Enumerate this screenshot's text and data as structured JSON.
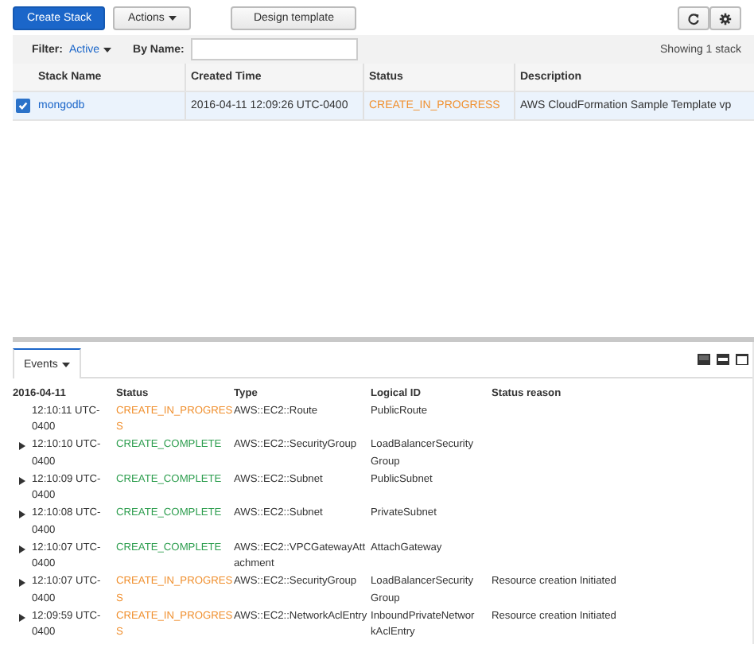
{
  "toolbar": {
    "create_button": "Create Stack",
    "actions_button": "Actions",
    "design_button": "Design template"
  },
  "filter": {
    "label": "Filter:",
    "value": "Active",
    "by_name_label": "By Name:",
    "count": "Showing 1 stack"
  },
  "stacks": {
    "columns": [
      "Stack Name",
      "Created Time",
      "Status",
      "Description"
    ],
    "rows": [
      {
        "checked": true,
        "selected": true,
        "name": "mongodb",
        "created": "2016-04-11 12:09:26 UTC-0400",
        "status": "CREATE_IN_PROGRESS",
        "color": "#f0902f",
        "description": "AWS CloudFormation Sample Template vp"
      }
    ]
  },
  "tabs": [
    {
      "label": "Events",
      "selected": true
    }
  ],
  "events": {
    "date": "2016-04-11",
    "columns": [
      "Status",
      "Type",
      "Logical ID",
      "Status reason"
    ],
    "rows": [
      {
        "expandable": false,
        "time": "12:10:11 UTC-0400",
        "status": "CREATE_IN_PROGRESS",
        "color": "#f0902f",
        "type": "AWS::EC2::Route",
        "logical_id": "PublicRoute"
      },
      {
        "expandable": true,
        "time": "12:10:10 UTC-0400",
        "status": "CREATE_COMPLETE",
        "color": "#2e9e4f",
        "type": "AWS::EC2::SecurityGroup",
        "logical_id": "LoadBalancerSecurityGroup"
      },
      {
        "expandable": true,
        "time": "12:10:09 UTC-0400",
        "status": "CREATE_COMPLETE",
        "color": "#2e9e4f",
        "type": "AWS::EC2::Subnet",
        "logical_id": "PublicSubnet"
      },
      {
        "expandable": true,
        "time": "12:10:08 UTC-0400",
        "status": "CREATE_COMPLETE",
        "color": "#2e9e4f",
        "type": "AWS::EC2::Subnet",
        "logical_id": "PrivateSubnet"
      },
      {
        "expandable": true,
        "time": "12:10:07 UTC-0400",
        "status": "CREATE_COMPLETE",
        "color": "#2e9e4f",
        "type": "AWS::EC2::VPCGatewayAttachment",
        "logical_id": "AttachGateway"
      },
      {
        "expandable": true,
        "time": "12:10:07 UTC-0400",
        "status": "CREATE_IN_PROGRESS",
        "color": "#f0902f",
        "type": "AWS::EC2::SecurityGroup",
        "logical_id": "LoadBalancerSecurityGroup",
        "reason": "Resource creation Initiated"
      },
      {
        "expandable": true,
        "time": "12:09:59 UTC-0400",
        "status": "CREATE_IN_PROGRESS",
        "color": "#f0902f",
        "type": "AWS::EC2::NetworkAclEntry",
        "logical_id": "InboundPrivateNetworkAclEntry",
        "reason": "Resource creation Initiated"
      }
    ]
  }
}
